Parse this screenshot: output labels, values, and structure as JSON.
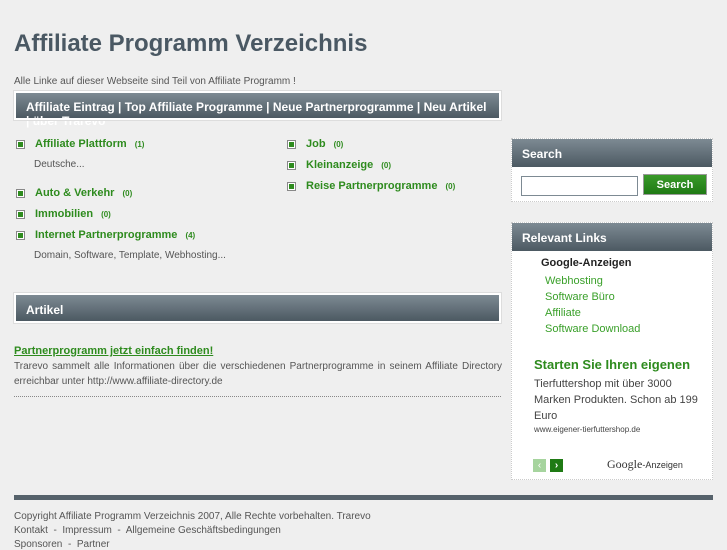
{
  "header": {
    "title": "Affiliate Programm Verzeichnis",
    "tagline": "Alle Linke auf dieser Webseite sind Teil von Affiliate Programm !"
  },
  "nav": [
    "Affiliate Eintrag",
    "Top Affiliate Programme",
    "Neue Partnerprogramme",
    "Neu Artikel",
    "über Trarevo"
  ],
  "nav_sep": "|",
  "categories_left": [
    {
      "label": "Affiliate Plattform",
      "count": "(1)",
      "sub": "Deutsche..."
    },
    {
      "label": "Auto & Verkehr",
      "count": "(0)"
    },
    {
      "label": "Immobilien",
      "count": "(0)"
    },
    {
      "label": "Internet Partnerprogramme",
      "count": "(4)",
      "sub": "Domain, Software, Template, Webhosting..."
    }
  ],
  "categories_right": [
    {
      "label": "Job",
      "count": "(0)"
    },
    {
      "label": "Kleinanzeige",
      "count": "(0)"
    },
    {
      "label": "Reise Partnerprogramme",
      "count": "(0)"
    }
  ],
  "articles": {
    "heading": "Artikel",
    "title": "Partnerprogramm jetzt einfach finden!",
    "text": "Trarevo sammelt alle Informationen über die verschiedenen Partnerprogramme in seinem Affiliate Directory erreichbar unter http://www.affiliate-directory.de"
  },
  "search": {
    "heading": "Search",
    "value": "",
    "button": "Search"
  },
  "links": {
    "heading": "Relevant Links",
    "ads_label": "Google-Anzeigen",
    "items": [
      "Webhosting",
      "Software Büro",
      "Affiliate",
      "Software Download"
    ],
    "ad": {
      "title": "Starten Sie Ihren eigenen",
      "text": "Tierfuttershop mit über 3000 Marken Produkten. Schon ab 199 Euro",
      "url": "www.eigener-tierfuttershop.de"
    },
    "google": "Google",
    "anzeigen": "-Anzeigen"
  },
  "footer": {
    "copyright": "Copyright Affiliate Programm Verzeichnis 2007, Alle Rechte vorbehalten. Trarevo",
    "links": [
      "Kontakt",
      "Impressum",
      "Allgemeine Geschäftsbedingungen"
    ],
    "links2": [
      "Sponsoren",
      "Partner"
    ],
    "sep": "-"
  }
}
